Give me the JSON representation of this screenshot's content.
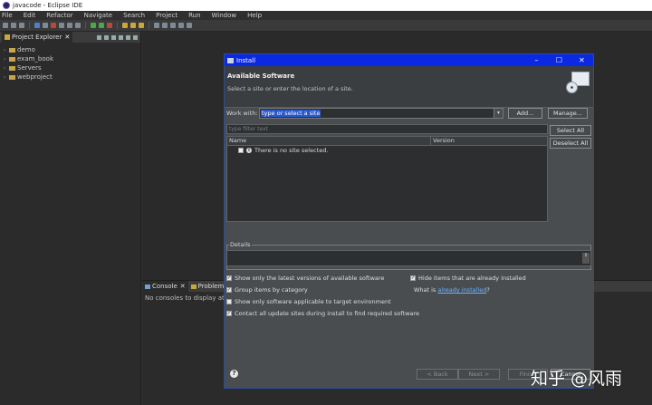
{
  "window": {
    "title": "javacode - Eclipse IDE"
  },
  "menu": [
    "File",
    "Edit",
    "Refactor",
    "Navigate",
    "Search",
    "Project",
    "Run",
    "Window",
    "Help"
  ],
  "explorer": {
    "tab_label": "Project Explorer",
    "close_glyph": "✕",
    "items": [
      "demo",
      "exam_book",
      "Servers",
      "webproject"
    ]
  },
  "console": {
    "tabs": [
      "Console",
      "Problems"
    ],
    "close_glyph": "✕",
    "message": "No consoles to display at th"
  },
  "dialog": {
    "title": "Install",
    "heading": "Available Software",
    "subtitle": "Select a site or enter the location of a site.",
    "work_with_label": "Work with:",
    "work_with_value": "type or select a site",
    "add_button": "Add...",
    "manage_button": "Manage...",
    "filter_placeholder": "type filter text",
    "select_all": "Select All",
    "deselect_all": "Deselect All",
    "columns": [
      "Name",
      "Version"
    ],
    "empty_row": "There is no site selected.",
    "details_label": "Details",
    "options": {
      "latest_versions": "Show only the latest versions of available software",
      "hide_installed": "Hide items that are already installed",
      "group_by_category": "Group items by category",
      "what_is_prefix": "What is",
      "what_is_link": "already installed",
      "what_is_suffix": "?",
      "target_env": "Show only software applicable to target environment",
      "contact_sites": "Contact all update sites during install to find required software"
    },
    "footer": {
      "help": "?",
      "back": "< Back",
      "next": "Next >",
      "finish": "Finish",
      "cancel": "Cancel"
    }
  },
  "watermark": "知乎 @风雨",
  "colors": {
    "title_bar": "#0b28e3",
    "link": "#6fb3ff",
    "selection": "#2a58c9"
  }
}
